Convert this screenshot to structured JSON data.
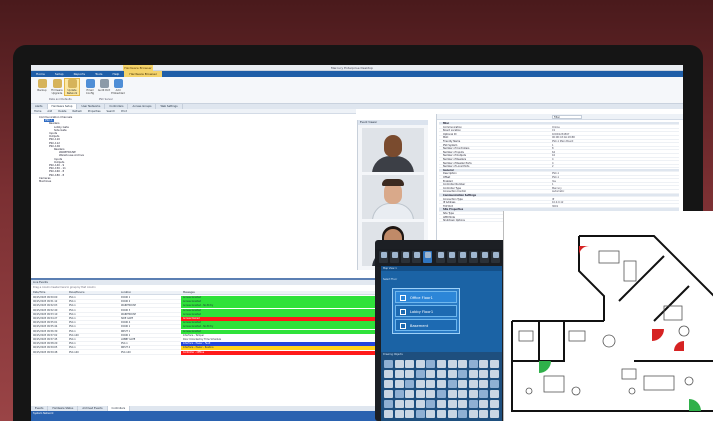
{
  "app": {
    "title": "Mercury Enterprise Desktop",
    "context_tab": "Hardware Browser",
    "context_group": "Hardware Browser"
  },
  "menu": [
    "Home",
    "Setup",
    "Reports",
    "Tools",
    "Help",
    "Hardware Browser"
  ],
  "ribbon": {
    "buttons": [
      "Backup",
      "Firmware Upgrade",
      "Update Network",
      "Email Config",
      "Audit Port",
      "Add Embedded"
    ],
    "groups": [
      "Data and Defaults",
      "PSC Server"
    ]
  },
  "tabs": [
    "Alerts",
    "Hardware Setup",
    "User Networks",
    "Controllers",
    "Access Groups",
    "Web Settings"
  ],
  "toolbar": [
    "Home",
    "Add",
    "Delete",
    "Refresh",
    "Properties",
    "Search",
    "Print"
  ],
  "tree": [
    {
      "t": "Communication Channels",
      "lv": 1
    },
    {
      "t": "PSC-1",
      "lv": 2,
      "sel": true
    },
    {
      "t": "Readers",
      "lv": 3
    },
    {
      "t": "Lobby Gate",
      "lv": 4
    },
    {
      "t": "Side Gate",
      "lv": 4
    },
    {
      "t": "Inputs",
      "lv": 3
    },
    {
      "t": "Outputs",
      "lv": 3
    },
    {
      "t": "PSC-110",
      "lv": 3,
      "dot": true
    },
    {
      "t": "PSC-112",
      "lv": 3,
      "dot": true
    },
    {
      "t": "PSC-1X6",
      "lv": 3
    },
    {
      "t": "Readers",
      "lv": 4
    },
    {
      "t": "WAREHOUSE",
      "lv": 5
    },
    {
      "t": "Warehouse Archive",
      "lv": 5
    },
    {
      "t": "Inputs",
      "lv": 4
    },
    {
      "t": "Outputs",
      "lv": 4
    },
    {
      "t": "PSC-140 - 9",
      "lv": 3,
      "dot": true
    },
    {
      "t": "PSC-150 - 11",
      "lv": 3
    },
    {
      "t": "PSC-160 - 8",
      "lv": 3
    },
    {
      "t": "PSC-180 - 8",
      "lv": 3
    },
    {
      "t": "Cameras",
      "lv": 1
    },
    {
      "t": "Machines",
      "lv": 1
    }
  ],
  "camera_panel": {
    "title": "Event Viewer"
  },
  "properties": {
    "search": "Filter",
    "rows": [
      {
        "k": "Misc",
        "v": "",
        "sec": true
      },
      {
        "k": "Communication",
        "v": "Online"
      },
      {
        "k": "Board Location",
        "v": "C1"
      },
      {
        "k": "Optional ID",
        "v": "1D0D1234567"
      },
      {
        "k": "MAC",
        "v": "00:0D:43:0A:18:8D"
      },
      {
        "k": "Friendly Name",
        "v": "PSC-1 Main Board"
      },
      {
        "k": "PSC System",
        "v": "1"
      },
      {
        "k": "Number of Controllers",
        "v": "8"
      },
      {
        "k": "Number of Inputs",
        "v": "64"
      },
      {
        "k": "Number of Outputs",
        "v": "16"
      },
      {
        "k": "Number of Readers",
        "v": "4"
      },
      {
        "k": "Number of Reader Ports",
        "v": "4"
      },
      {
        "k": "Number of Local Ports",
        "v": "2"
      },
      {
        "k": "General",
        "v": "",
        "sec": true
      },
      {
        "k": "Description",
        "v": "PSC-1"
      },
      {
        "k": "Offset",
        "v": "PSC-1"
      },
      {
        "k": "Enabled",
        "v": "Yes"
      },
      {
        "k": "Controller Number",
        "v": "1"
      },
      {
        "k": "Controller Type",
        "v": "Mercury"
      },
      {
        "k": "Connection Control",
        "v": "Automatic"
      },
      {
        "k": "Communication Settings",
        "v": "",
        "sec": true
      },
      {
        "k": "Connection Type",
        "v": "IP"
      },
      {
        "k": "IP Address",
        "v": "10.0.0.12"
      },
      {
        "k": "TCP Port",
        "v": "3001"
      },
      {
        "k": "Site Properties",
        "v": "",
        "sec": true
      },
      {
        "k": "Site Type",
        "v": "Mercury"
      },
      {
        "k": "APB Mode",
        "v": "Off"
      },
      {
        "k": "Shutdown Options",
        "v": ""
      }
    ]
  },
  "events": {
    "title": "Live Events",
    "hint": "Drag a column header here to group by that column",
    "cols": [
      "Date/Time",
      "Panel/Device",
      "Location",
      "Messages"
    ],
    "rows": [
      {
        "d": "06/15/2023 09:50:00",
        "p": "PSC-1",
        "l": "DOOR 1",
        "m": "Access Granted",
        "c": "#2fe23a"
      },
      {
        "d": "06/15/2023 09:51:12",
        "p": "PSC-1",
        "l": "DOOR 2",
        "m": "Access Granted",
        "c": "#2fe23a"
      },
      {
        "d": "06/15/2023 09:52:03",
        "p": "PSC-1",
        "l": "WAREHOUSE",
        "m": "Access Granted - No Entry",
        "c": "#2fe23a"
      },
      {
        "d": "06/15/2023 09:52:40",
        "p": "PSC-1",
        "l": "DOOR 3",
        "m": "Access Granted",
        "c": "#2fe23a"
      },
      {
        "d": "06/15/2023 09:53:10",
        "p": "PSC-1",
        "l": "WAREHOUSE",
        "m": "Access Granted",
        "c": "#2fe23a"
      },
      {
        "d": "06/15/2023 09:54:27",
        "p": "PSC-1",
        "l": "SIDE GATE",
        "m": "Access Denied",
        "c": "#ff1a1a"
      },
      {
        "d": "06/15/2023 09:55:01",
        "p": "PSC-1",
        "l": "DOOR 4",
        "m": "Access Granted",
        "c": "#2fe23a"
      },
      {
        "d": "06/15/2023 09:55:44",
        "p": "PSC-1",
        "l": "DOOR 1",
        "m": "Access Granted - No Entry",
        "c": "#2fe23a"
      },
      {
        "d": "06/15/2023 09:56:30",
        "p": "PSC-1",
        "l": "INPUT 1",
        "m": "Access Granted",
        "c": "#2fe23a"
      },
      {
        "d": "06/15/2023 09:57:02",
        "p": "PSC-140",
        "l": "DOOR 1",
        "m": "Interface - Tamper",
        "c": "#ffffff"
      },
      {
        "d": "06/15/2023 09:57:45",
        "p": "PSC-1",
        "l": "LOBBY GATE",
        "m": "Door Unlocked by Time Schedule",
        "c": "#ffffff"
      },
      {
        "d": "06/15/2023 09:58:20",
        "p": "PSC-1",
        "l": "PSC-1",
        "m": "Interface - Power - Fault",
        "c": "#2244dd"
      },
      {
        "d": "06/15/2023 09:59:05",
        "p": "PSC-1",
        "l": "INPUT 4",
        "m": "Interface - Power - Restore",
        "c": "#ffd21a"
      },
      {
        "d": "06/15/2023 09:59:48",
        "p": "PSC-140",
        "l": "PSC-140",
        "m": "Controller - Offline",
        "c": "#ff1a1a"
      }
    ],
    "tabs": [
      "Events",
      "Hardware Status",
      "Archived Events",
      "Controllers"
    ]
  },
  "status_text": "System Network",
  "tablet": {
    "header": "Map View 1",
    "subheader": "Select Floor",
    "floors": [
      "Office Floor1",
      "Lobby Floor1",
      "Basement"
    ],
    "palette_title": "Drawing Objects"
  }
}
